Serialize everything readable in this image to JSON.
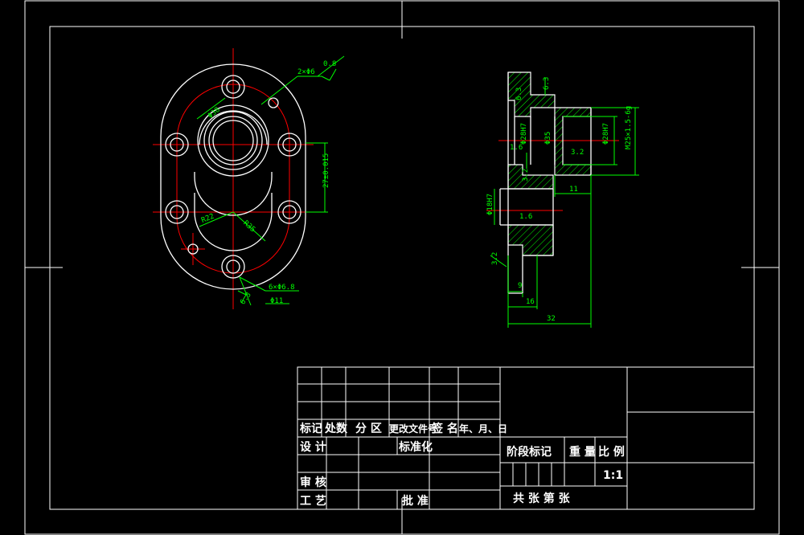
{
  "drawing": {
    "left_view": {
      "dims": {
        "thread_holes": "2×Φ6",
        "surface_finish_top": "0.8",
        "dia_small": "Φ38",
        "height": "27±0.015",
        "r_left": "R22",
        "r_right": "R35",
        "chamfer": "6×Φ6.8",
        "through": "Φ11",
        "finish_bottom": "6.3"
      }
    },
    "right_view": {
      "dims": {
        "finish_top_right": "6.3",
        "finish_top_inner": "6.3",
        "dia_inner_left": "Φ28H7",
        "dia_center": "Φ35",
        "finish_inner": "3.2",
        "dia_inner_right": "Φ28H7",
        "thread": "M25×1.5-6g",
        "finish_left": "1.6",
        "finish_step": "3.2",
        "len_11": "11",
        "dia_bore": "Φ18H7",
        "finish_bore": "1.6",
        "finish_bottom": "3.2",
        "len_9": "9",
        "len_16": "16",
        "len_32": "32"
      }
    }
  },
  "title_block": {
    "header": {
      "mark": "标记",
      "count": "处数",
      "zone": "分 区",
      "change_doc": "更改文件号",
      "signature": "签 名",
      "date": "年、月、日"
    },
    "design": "设 计",
    "standardize": "标准化",
    "review": "审 核",
    "process": "工 艺",
    "approve": "批 准",
    "stage_mark": "阶段标记",
    "weight": "重 量",
    "scale_label": "比 例",
    "scale_value": "1:1",
    "sheets": "共    张  第    张"
  }
}
